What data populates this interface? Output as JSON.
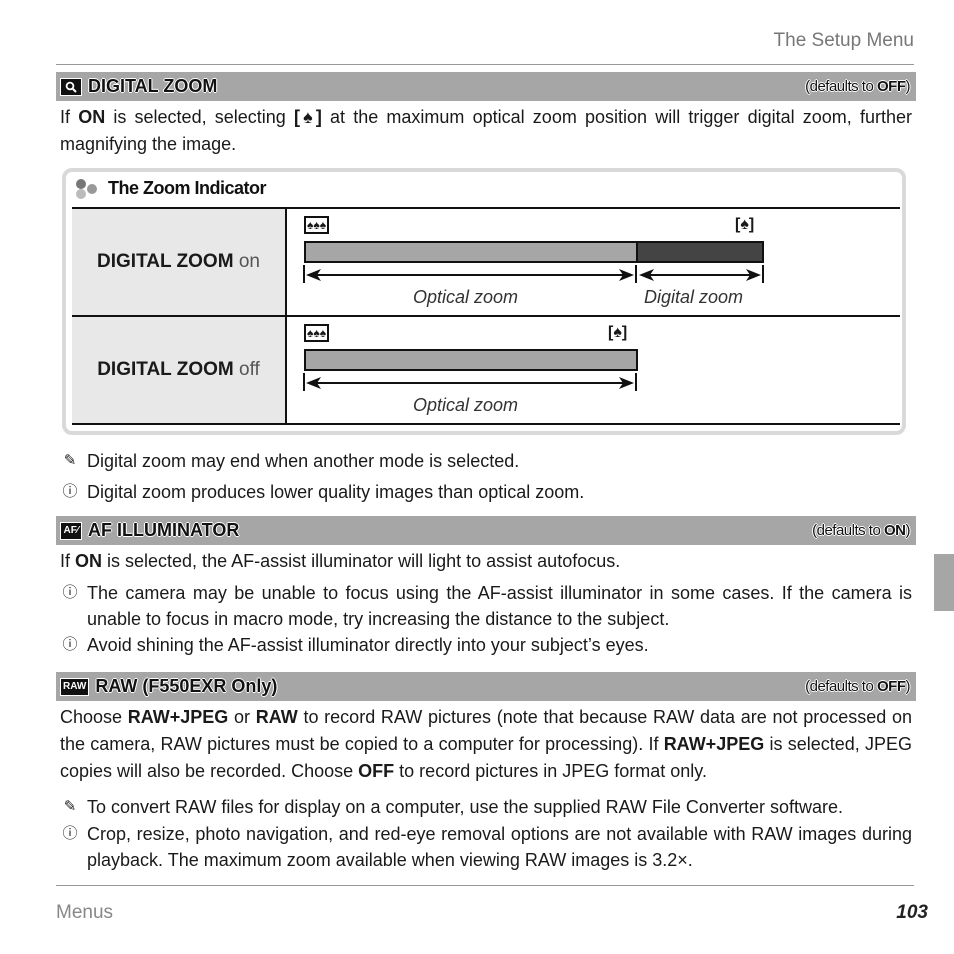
{
  "header": {
    "running_title": "The Setup Menu"
  },
  "footer": {
    "section": "Menus",
    "page_number": "103"
  },
  "sections": [
    {
      "icon": "digital-zoom-icon",
      "icon_glyph": "🔍",
      "title": "DIGITAL ZOOM",
      "default_prefix": "(defaults to ",
      "default_value": "OFF",
      "default_suffix": ")",
      "intro": {
        "pre": "If ",
        "bold1": "ON",
        "mid": " is selected, selecting ",
        "symbol": "[♠]",
        "post": " at the maximum optical zoom position will trigger digital zoom, further magnifying the image."
      },
      "info_box": {
        "title": "The Zoom Indicator",
        "rows": [
          {
            "label_bold": "DIGITAL ZOOM",
            "label_state": " on",
            "wide_icon": "♠♠♠",
            "tele_icon": "[♠]",
            "captions": [
              "Optical zoom",
              "Digital zoom"
            ]
          },
          {
            "label_bold": "DIGITAL ZOOM",
            "label_state": " off",
            "wide_icon": "♠♠♠",
            "tele_icon": "[♠]",
            "captions": [
              "Optical zoom"
            ]
          }
        ]
      },
      "notes": [
        {
          "type": "note",
          "glyph": "✎",
          "text": "Digital zoom may end when another mode is selected."
        },
        {
          "type": "caution",
          "glyph": "⓵",
          "text": "Digital zoom produces lower quality images than optical zoom."
        }
      ]
    },
    {
      "icon": "af-illuminator-icon",
      "icon_glyph": "AF",
      "title": "AF ILLUMINATOR",
      "default_prefix": "(defaults to ",
      "default_value": "ON",
      "default_suffix": ")",
      "intro": {
        "pre": "If ",
        "bold1": "ON",
        "post": " is selected, the AF-assist illuminator will light to assist autofocus."
      },
      "notes": [
        {
          "type": "caution",
          "glyph": "!",
          "text": "The camera may be unable to focus using the AF-assist illuminator in some cases.  If the camera is unable to focus in macro mode, try increasing the distance to the subject."
        },
        {
          "type": "caution",
          "glyph": "!",
          "text": "Avoid shining the AF-assist illuminator directly into your subject’s eyes."
        }
      ]
    },
    {
      "icon": "raw-icon",
      "icon_glyph": "RAW",
      "title": "RAW (F550EXR Only)",
      "default_prefix": "(defaults to ",
      "default_value": "OFF",
      "default_suffix": ")",
      "intro": {
        "t1": "Choose ",
        "b1": "RAW+JPEG",
        "t2": " or ",
        "b2": "RAW",
        "t3": " to record RAW pictures (note that because RAW data are not processed on the camera, RAW pictures must be copied to a computer for processing).  If ",
        "b3": "RAW+JPEG",
        "t4": " is selected, JPEG copies will also be recorded.  Choose ",
        "b4": "OFF",
        "t5": " to record pictures in JPEG format only."
      },
      "notes": [
        {
          "type": "note",
          "glyph": "✎",
          "text": "To convert RAW files for display on a computer, use the supplied RAW File Converter software."
        },
        {
          "type": "caution",
          "glyph": "!",
          "text": "Crop, resize, photo navigation, and red-eye removal options are not available with RAW images during playback.  The maximum zoom available when viewing RAW images is 3.2×."
        }
      ]
    }
  ],
  "colors": {
    "bar_gray": "#a6a6a6",
    "digital_dark": "#444444",
    "label_bg": "#e8e8e8",
    "box_border": "#d9d9d9"
  }
}
